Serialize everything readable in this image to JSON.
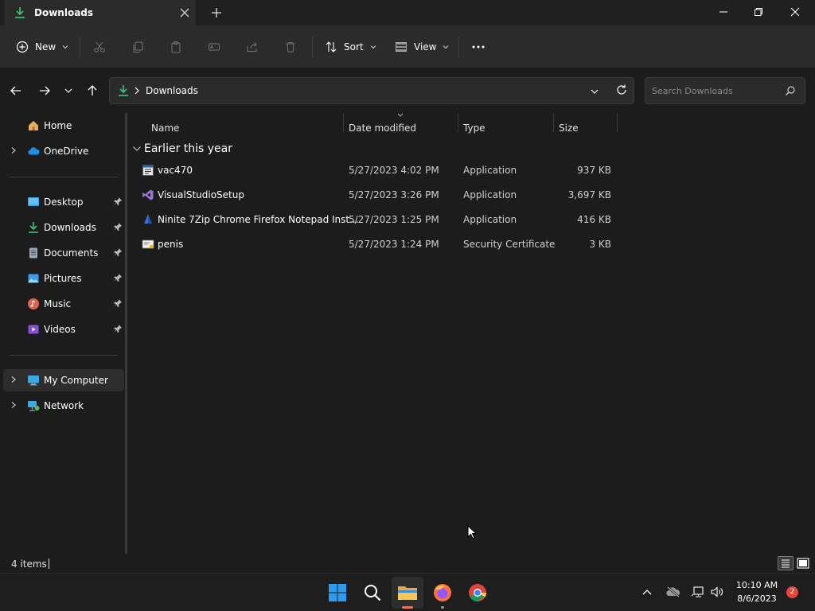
{
  "window": {
    "tab_title": "Downloads"
  },
  "toolbar": {
    "new_label": "New",
    "sort_label": "Sort",
    "view_label": "View"
  },
  "address": {
    "path": "Downloads"
  },
  "search": {
    "placeholder": "Search Downloads"
  },
  "sidebar": {
    "items": [
      {
        "label": "Home"
      },
      {
        "label": "OneDrive"
      },
      {
        "label": "Desktop"
      },
      {
        "label": "Downloads"
      },
      {
        "label": "Documents"
      },
      {
        "label": "Pictures"
      },
      {
        "label": "Music"
      },
      {
        "label": "Videos"
      },
      {
        "label": "My Computer"
      },
      {
        "label": "Network"
      }
    ]
  },
  "columns": {
    "name": "Name",
    "date": "Date modified",
    "type": "Type",
    "size": "Size"
  },
  "group": {
    "label": "Earlier this year"
  },
  "files": [
    {
      "name": "vac470",
      "date": "5/27/2023 4:02 PM",
      "type": "Application",
      "size": "937 KB"
    },
    {
      "name": "VisualStudioSetup",
      "date": "5/27/2023 3:26 PM",
      "type": "Application",
      "size": "3,697 KB"
    },
    {
      "name": "Ninite 7Zip Chrome Firefox Notepad Inst...",
      "date": "5/27/2023 1:25 PM",
      "type": "Application",
      "size": "416 KB"
    },
    {
      "name": "penis",
      "date": "5/27/2023 1:24 PM",
      "type": "Security Certificate",
      "size": "3 KB"
    }
  ],
  "status": {
    "item_count": "4 items"
  },
  "taskbar": {
    "time": "10:10 AM",
    "date": "8/6/2023",
    "notification_count": "2"
  },
  "colors": {
    "accent": "#4cc2ff",
    "folder_green": "#3fc37a",
    "background": "#1c1c1c"
  }
}
